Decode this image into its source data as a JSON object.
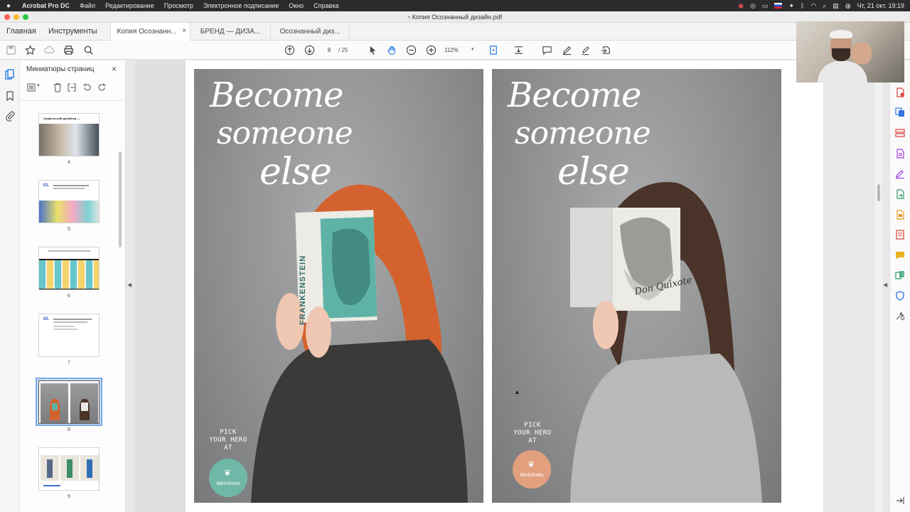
{
  "menubar": {
    "apple": "",
    "items": [
      "Acrobat Pro DC",
      "Файл",
      "Редактирование",
      "Просмотр",
      "Электронное подписание",
      "Окно",
      "Справка"
    ],
    "clock": "Чт, 21 окт.  19:19"
  },
  "window": {
    "title": "Копия Осознанный дизайн.pdf",
    "traffic_lights": [
      "#fe5f57",
      "#febc2e",
      "#28c840"
    ]
  },
  "nav": {
    "home": "Главная",
    "tools": "Инструменты",
    "doc_tabs": [
      {
        "label": "Копия Осознанн...",
        "close": "×"
      },
      {
        "label": "БРЕНД — ДИЗА..."
      },
      {
        "label": "Осознанный диз..."
      }
    ]
  },
  "toolbar": {
    "page_current": "8",
    "page_total": "/  25",
    "zoom": "112%",
    "zoom_caret": "▾"
  },
  "thumbnails": {
    "title": "Миниатюры страниц",
    "close": "×",
    "pages": [
      {
        "num": "4",
        "heading": "Графический дизайнер —"
      },
      {
        "num": "5",
        "heading": "01."
      },
      {
        "num": "6"
      },
      {
        "num": "7",
        "heading": "02."
      },
      {
        "num": "8",
        "selected": true
      },
      {
        "num": "9"
      }
    ]
  },
  "document": {
    "posters": [
      {
        "headline": [
          "Become",
          "someone",
          "else"
        ],
        "book": "FRANKENSTEIN",
        "pick": [
          "PICK",
          "YOUR HERO",
          "AT"
        ],
        "brand": "MintVinetu",
        "logo_color": "#6fb7a6",
        "hair_color": "#d4622f",
        "book_color": "#5fb3a6"
      },
      {
        "headline": [
          "Become",
          "someone",
          "else"
        ],
        "book": "Don Quixote",
        "pick": [
          "PICK",
          "YOUR HERO",
          "AT"
        ],
        "brand": "MintVinetu",
        "logo_color": "#e2a07f",
        "hair_color": "#4a3328",
        "book_color": "#e8e8e6"
      }
    ]
  },
  "colors": {
    "accent": "#1473e6",
    "selection": "#7aa7e3"
  }
}
